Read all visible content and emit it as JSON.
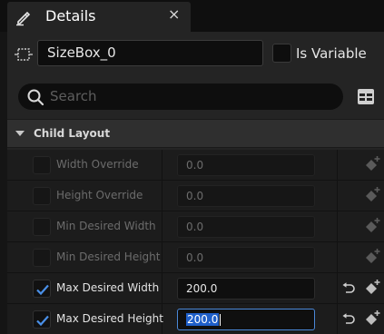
{
  "tab": {
    "title": "Details",
    "close_glyph": "×",
    "icon": "pencil-icon"
  },
  "header": {
    "widget_name": "SizeBox_0",
    "is_variable_label": "Is Variable",
    "is_variable_checked": false
  },
  "search": {
    "placeholder": "Search"
  },
  "category": {
    "title": "Child Layout",
    "expanded": true
  },
  "properties": [
    {
      "label": "Width Override",
      "checked": false,
      "enabled": false,
      "value": "0.0",
      "resettable": false
    },
    {
      "label": "Height Override",
      "checked": false,
      "enabled": false,
      "value": "0.0",
      "resettable": false
    },
    {
      "label": "Min Desired Width",
      "checked": false,
      "enabled": false,
      "value": "0.0",
      "resettable": false
    },
    {
      "label": "Min Desired Height",
      "checked": false,
      "enabled": false,
      "value": "0.0",
      "resettable": false
    },
    {
      "label": "Max Desired Width",
      "checked": true,
      "enabled": true,
      "value": "200.0",
      "resettable": true
    },
    {
      "label": "Max Desired Height",
      "checked": true,
      "enabled": true,
      "value": "200.0",
      "resettable": true,
      "focused": true
    }
  ],
  "colors": {
    "accent": "#4a88d8",
    "selection": "#1f5fc9",
    "panel": "#242424"
  }
}
